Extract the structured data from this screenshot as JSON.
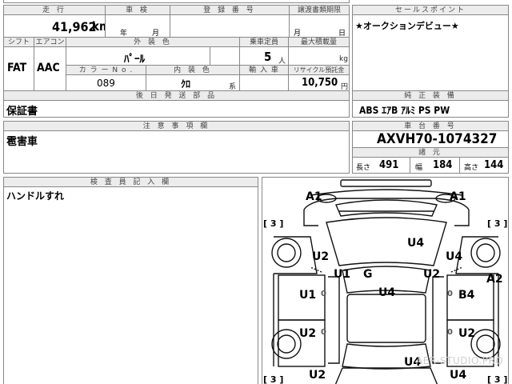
{
  "header": {
    "mileage_label": "走 行",
    "mileage_value": "41,962",
    "mileage_unit": "km",
    "inspection_label": "車 検",
    "inspection_year": "年",
    "inspection_month": "月",
    "reg_label": "登 録 番 号",
    "transfer_label": "譲渡書類期限",
    "transfer_month": "月",
    "transfer_day": "日",
    "salespoint_label": "セールスポイント",
    "salespoint_text": "★オークションデビュー★"
  },
  "specs": {
    "shift_label": "シフト",
    "shift_value": "FAT",
    "aircon_label": "エアコン",
    "aircon_value": "AAC",
    "exterior_color_label": "外 装 色",
    "exterior_color_value": "ﾊﾟｰﾙ",
    "capacity_label": "乗車定員",
    "capacity_value": "5",
    "capacity_unit": "人",
    "max_load_label": "最大積載量",
    "max_load_unit": "kg",
    "color_no_label": "カ ラ ー N o .",
    "color_no_value": "089",
    "interior_color_label": "内 装 色",
    "interior_color_value": "ｸﾛ",
    "interior_suffix": "系",
    "import_label": "輸 入 車",
    "recycle_label": "リサイクル預託金",
    "recycle_value": "10,750",
    "recycle_unit": "円"
  },
  "delivery": {
    "label": "後 日 発 送 部 品",
    "value": "保証書"
  },
  "equipment": {
    "label": "純 正 装 備",
    "value": "ABS ｴｱB ｱﾙﾐ PS PW"
  },
  "notes": {
    "label": "注 意 事 項 欄",
    "value": "雹害車"
  },
  "chassis": {
    "label": "車 台 番 号",
    "value": "AXVH70-1074327",
    "dims_label": "諸 元",
    "length_label": "長さ",
    "length_value": "491",
    "width_label": "幅",
    "width_value": "184",
    "height_label": "高さ",
    "height_value": "144"
  },
  "inspector": {
    "label": "検 査 員 記 入 欄",
    "value": "ハンドルすれ"
  },
  "diagram": {
    "marks": {
      "a1_left": "A1",
      "a1_right": "A1",
      "bracket_tl": "[ 3 ]",
      "bracket_tr": "[ 3 ]",
      "bracket_bl": "[ 3 ]",
      "bracket_br": "[ 3 ]",
      "u4_hood": "U4",
      "u2_left_front": "U2",
      "u4_right_front": "U4",
      "u1_pillar": "U1",
      "g_windshield": "G",
      "u2_pillar": "U2",
      "a2_right": "A2",
      "u1_left_door": "U1",
      "u4_roof": "U4",
      "b4_right_door": "B4",
      "u2_left_rear": "U2",
      "u2_right_rear": "U2",
      "u2_left_bottom": "U2",
      "u4_trunk": "U4",
      "u4_right_bottom": "U4",
      "zero_1": "0",
      "zero_2": "0",
      "zero_3": "0",
      "zero_4": "0"
    },
    "watermark": "AER-STUDIO.PRO"
  }
}
